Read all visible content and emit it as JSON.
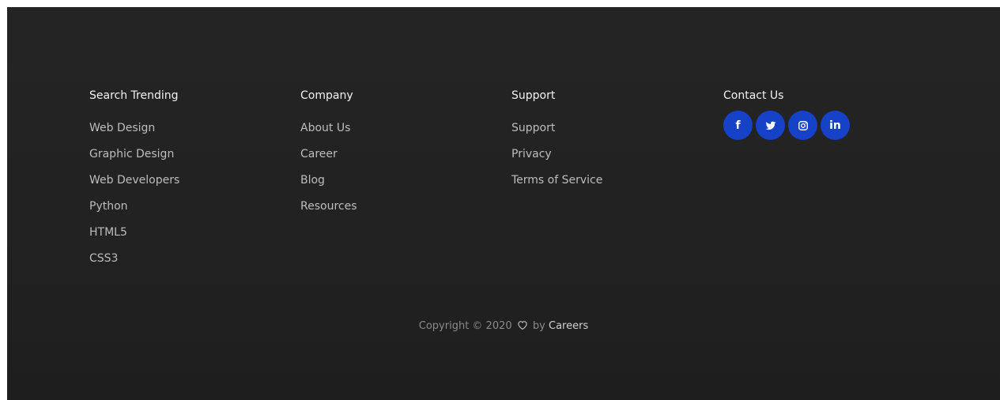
{
  "columns": [
    {
      "title": "Search Trending",
      "links": [
        "Web Design",
        "Graphic Design",
        "Web Developers",
        "Python",
        "HTML5",
        "CSS3"
      ]
    },
    {
      "title": "Company",
      "links": [
        "About Us",
        "Career",
        "Blog",
        "Resources"
      ]
    },
    {
      "title": "Support",
      "links": [
        "Support",
        "Privacy",
        "Terms of Service"
      ]
    },
    {
      "title": "Contact Us",
      "socials": [
        {
          "name": "facebook-icon",
          "glyph": "f"
        },
        {
          "name": "twitter-icon",
          "glyph": ""
        },
        {
          "name": "instagram-icon",
          "glyph": ""
        },
        {
          "name": "linkedin-icon",
          "glyph": "in"
        }
      ]
    }
  ],
  "copyright": {
    "prefix": "Copyright © 2020",
    "by": "by",
    "brand": "Careers"
  },
  "colors": {
    "background": "#222222",
    "social_button": "#1542c7",
    "link": "#bdbdbd",
    "heading": "#f2f2f2"
  }
}
